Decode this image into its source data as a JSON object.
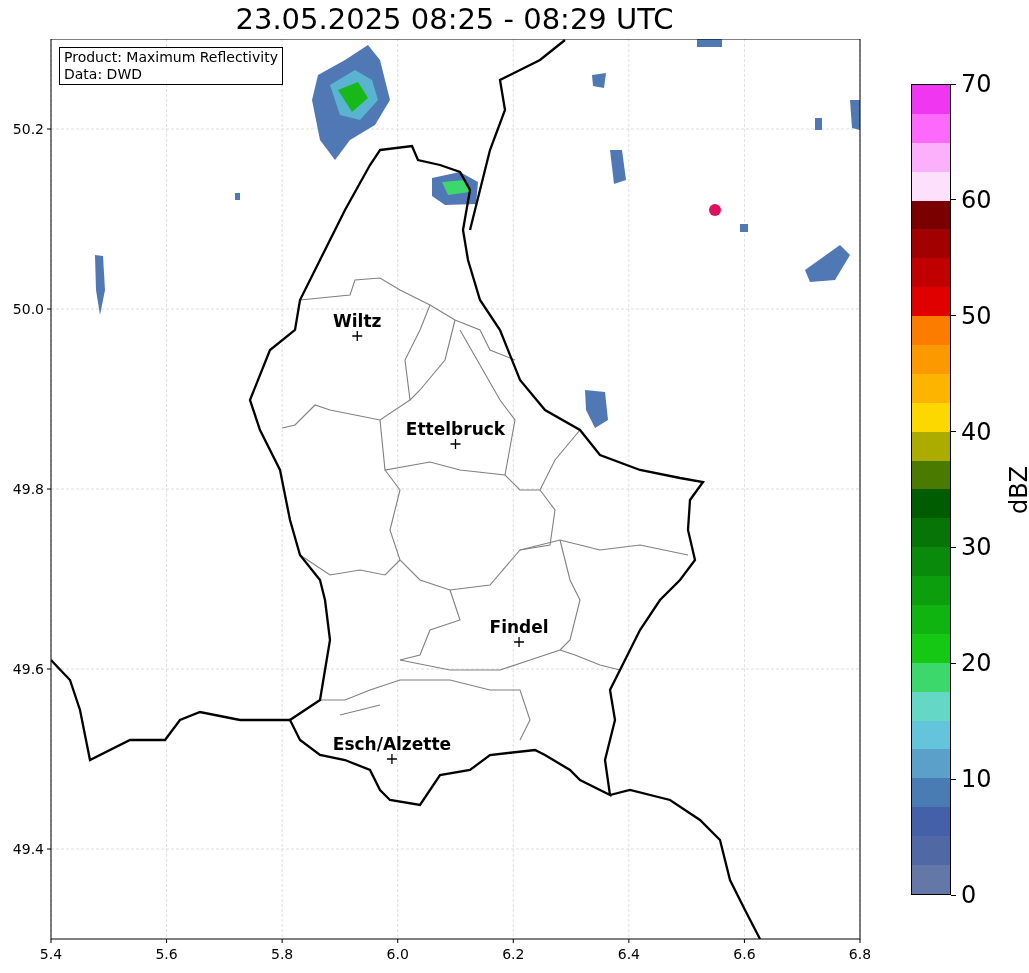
{
  "title": "23.05.2025 08:25 - 08:29 UTC",
  "map": {
    "info_lines": [
      "Product: Maximum Reflectivity",
      "Data: DWD"
    ],
    "chart_data": {
      "type": "scatter",
      "xlim": [
        5.4,
        6.8
      ],
      "ylim": [
        49.3,
        50.3
      ],
      "xticks": [
        {
          "value": 5.4,
          "label": "5.4"
        },
        {
          "value": 5.6,
          "label": "5.6"
        },
        {
          "value": 5.8,
          "label": "5.8"
        },
        {
          "value": 6.0,
          "label": "6.0"
        },
        {
          "value": 6.2,
          "label": "6.2"
        },
        {
          "value": 6.4,
          "label": "6.4"
        },
        {
          "value": 6.6,
          "label": "6.6"
        },
        {
          "value": 6.8,
          "label": "6.8"
        }
      ],
      "yticks": [
        {
          "value": 49.4,
          "label": "49.4"
        },
        {
          "value": 49.6,
          "label": "49.6"
        },
        {
          "value": 49.8,
          "label": "49.8"
        },
        {
          "value": 50.0,
          "label": "50.0"
        },
        {
          "value": 50.2,
          "label": "50.2"
        }
      ],
      "x": [
        5.93,
        6.1,
        6.21,
        5.99
      ],
      "grid": true,
      "series": [
        {
          "color": "#000000",
          "values": [
            49.97,
            49.85,
            49.63,
            49.5
          ]
        }
      ],
      "annotations": [
        {
          "text": "Wiltz",
          "x": 5.93,
          "y": 49.97
        },
        {
          "text": "Ettelbruck",
          "x": 6.1,
          "y": 49.85
        },
        {
          "text": "Findel",
          "x": 6.21,
          "y": 49.63
        },
        {
          "text": "Esch/Alzette",
          "x": 5.99,
          "y": 49.5
        }
      ]
    }
  },
  "colorbar": {
    "label": "dBZ",
    "ticks": [
      "70",
      "60",
      "50",
      "40",
      "30",
      "20",
      "10",
      "0"
    ],
    "bins": [
      {
        "color": "#f036f0"
      },
      {
        "color": "#fc6afc"
      },
      {
        "color": "#fcb0fc"
      },
      {
        "color": "#fce0fc"
      },
      {
        "color": "#7a0000"
      },
      {
        "color": "#a00000"
      },
      {
        "color": "#c00000"
      },
      {
        "color": "#e00000"
      },
      {
        "color": "#fc7c00"
      },
      {
        "color": "#fc9800"
      },
      {
        "color": "#fcb400"
      },
      {
        "color": "#fcd800"
      },
      {
        "color": "#acac00"
      },
      {
        "color": "#4a7a00"
      },
      {
        "color": "#005c00"
      },
      {
        "color": "#067406"
      },
      {
        "color": "#0a8a0a"
      },
      {
        "color": "#0c9e0c"
      },
      {
        "color": "#10b410"
      },
      {
        "color": "#14c814"
      },
      {
        "color": "#3cd86c"
      },
      {
        "color": "#64d8c4"
      },
      {
        "color": "#64c4dc"
      },
      {
        "color": "#5aa0c8"
      },
      {
        "color": "#4a7cb4"
      },
      {
        "color": "#4460a8"
      },
      {
        "color": "#5068a4"
      },
      {
        "color": "#6478a8"
      }
    ]
  }
}
